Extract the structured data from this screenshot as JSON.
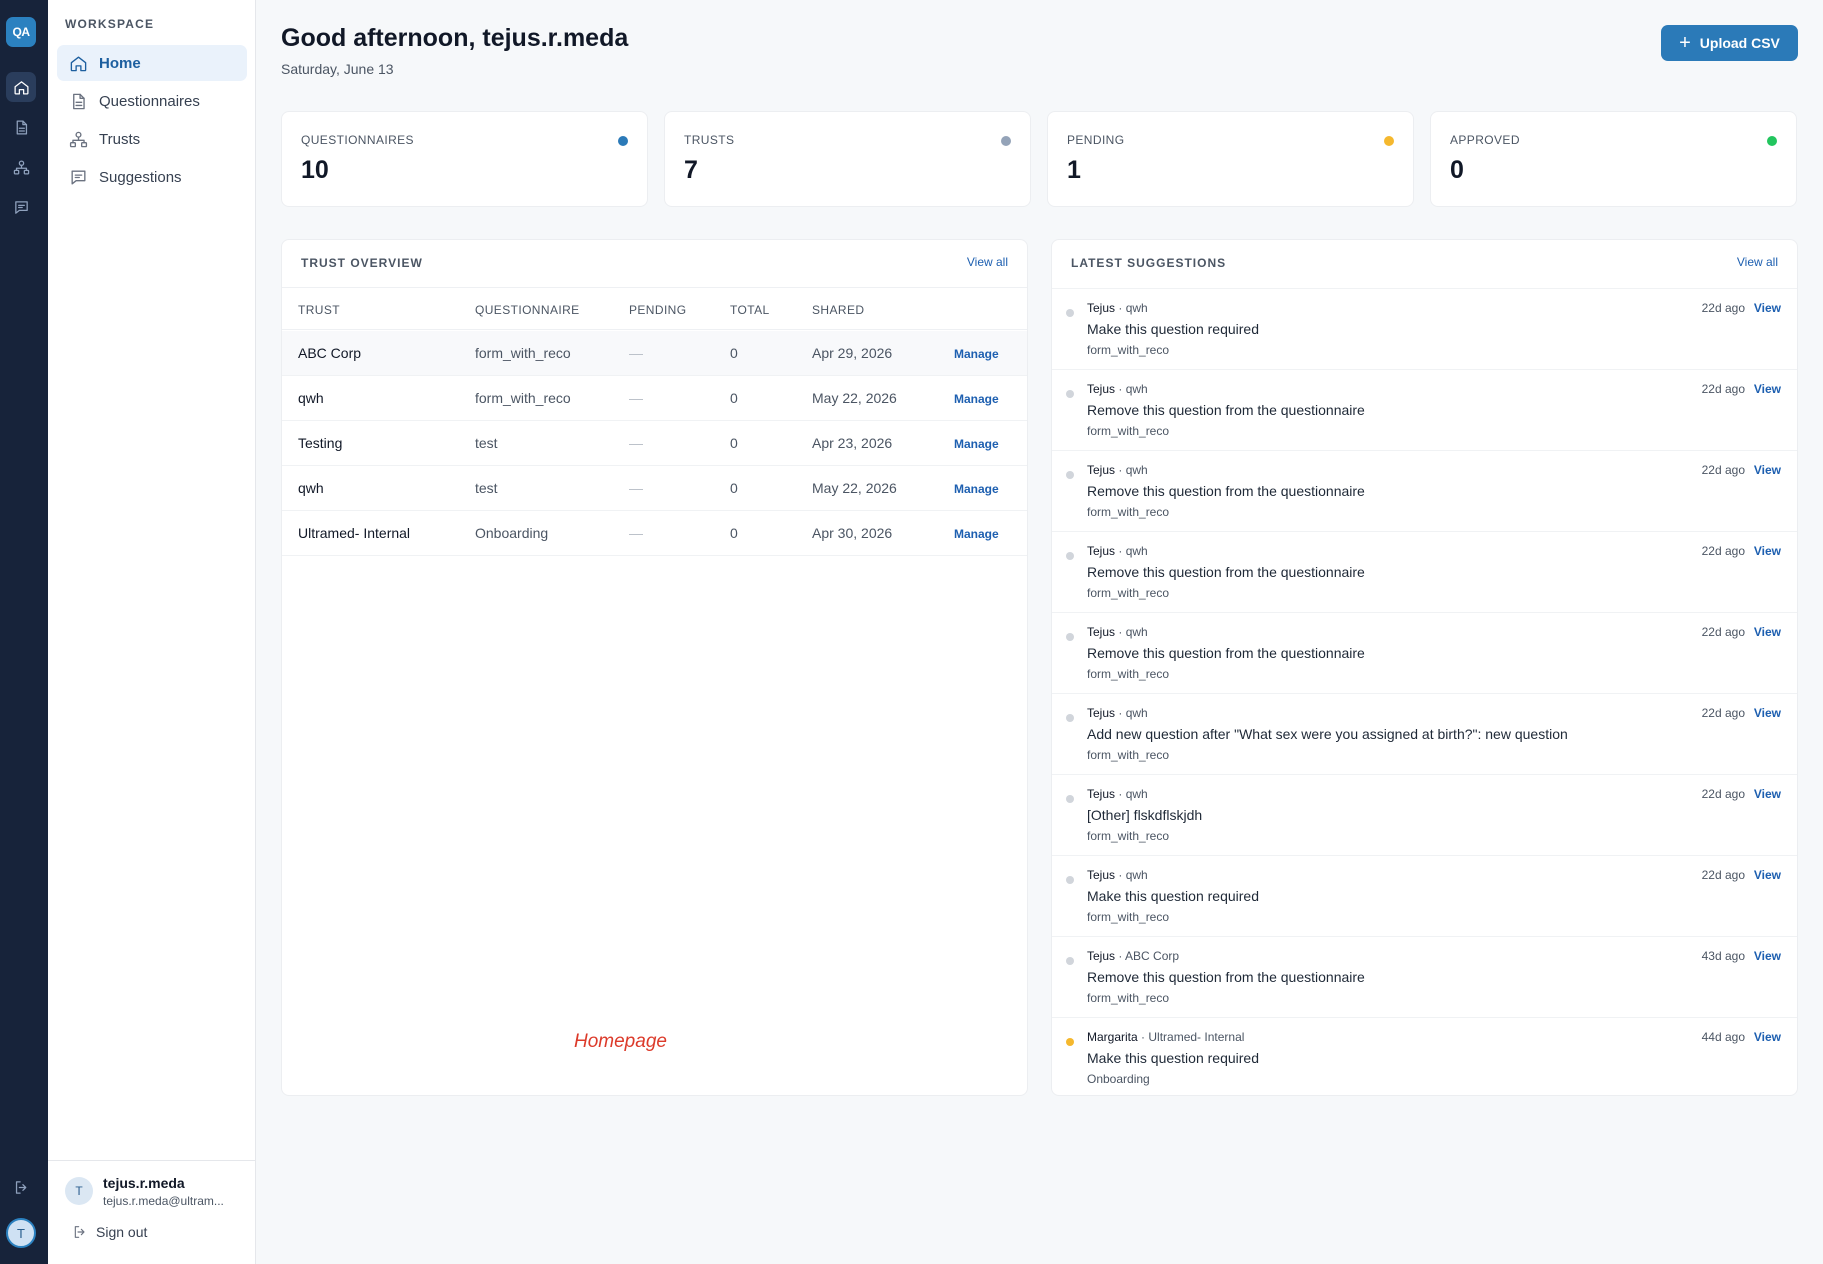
{
  "app": {
    "logo_text": "QA"
  },
  "rail": {
    "icons": [
      "home-icon",
      "document-icon",
      "trusts-icon",
      "chat-icon",
      "logout-icon"
    ],
    "avatar": "T"
  },
  "sidebar": {
    "section_title": "WORKSPACE",
    "items": [
      {
        "label": "Home",
        "icon": "home-icon",
        "active": true
      },
      {
        "label": "Questionnaires",
        "icon": "document-icon",
        "active": false
      },
      {
        "label": "Trusts",
        "icon": "trusts-icon",
        "active": false
      },
      {
        "label": "Suggestions",
        "icon": "chat-icon",
        "active": false
      }
    ],
    "user": {
      "avatar": "T",
      "name": "tejus.r.meda",
      "email": "tejus.r.meda@ultram...",
      "sign_out": "Sign out"
    }
  },
  "header": {
    "greeting": "Good afternoon, tejus.r.meda",
    "date": "Saturday, June 13",
    "upload_button": "Upload CSV"
  },
  "stats": [
    {
      "label": "QUESTIONNAIRES",
      "value": "10",
      "color": "#2b7ab8"
    },
    {
      "label": "TRUSTS",
      "value": "7",
      "color": "#94a3b8"
    },
    {
      "label": "PENDING",
      "value": "1",
      "color": "#f5b82e"
    },
    {
      "label": "APPROVED",
      "value": "0",
      "color": "#22c55e"
    }
  ],
  "trust_overview": {
    "title": "TRUST OVERVIEW",
    "view_all": "View all",
    "columns": [
      "TRUST",
      "QUESTIONNAIRE",
      "PENDING",
      "TOTAL",
      "SHARED"
    ],
    "rows": [
      {
        "trust": "ABC Corp",
        "questionnaire": "form_with_reco",
        "pending": "—",
        "total": "0",
        "shared": "Apr 29, 2026",
        "action": "Manage"
      },
      {
        "trust": "qwh",
        "questionnaire": "form_with_reco",
        "pending": "—",
        "total": "0",
        "shared": "May 22, 2026",
        "action": "Manage"
      },
      {
        "trust": "Testing",
        "questionnaire": "test",
        "pending": "—",
        "total": "0",
        "shared": "Apr 23, 2026",
        "action": "Manage"
      },
      {
        "trust": "qwh",
        "questionnaire": "test",
        "pending": "—",
        "total": "0",
        "shared": "May 22, 2026",
        "action": "Manage"
      },
      {
        "trust": "Ultramed- Internal",
        "questionnaire": "Onboarding",
        "pending": "—",
        "total": "0",
        "shared": "Apr 30, 2026",
        "action": "Manage"
      }
    ],
    "note": "Homepage"
  },
  "latest_suggestions": {
    "title": "LATEST SUGGESTIONS",
    "view_all": "View all",
    "items": [
      {
        "author": "Tejus",
        "sep": "·",
        "trust": "qwh",
        "text": "Make this question required",
        "form": "form_with_reco",
        "ago": "22d ago",
        "action": "View",
        "dot": "#d1d5db"
      },
      {
        "author": "Tejus",
        "sep": "·",
        "trust": "qwh",
        "text": "Remove this question from the questionnaire",
        "form": "form_with_reco",
        "ago": "22d ago",
        "action": "View",
        "dot": "#d1d5db"
      },
      {
        "author": "Tejus",
        "sep": "·",
        "trust": "qwh",
        "text": "Remove this question from the questionnaire",
        "form": "form_with_reco",
        "ago": "22d ago",
        "action": "View",
        "dot": "#d1d5db"
      },
      {
        "author": "Tejus",
        "sep": "·",
        "trust": "qwh",
        "text": "Remove this question from the questionnaire",
        "form": "form_with_reco",
        "ago": "22d ago",
        "action": "View",
        "dot": "#d1d5db"
      },
      {
        "author": "Tejus",
        "sep": "·",
        "trust": "qwh",
        "text": "Remove this question from the questionnaire",
        "form": "form_with_reco",
        "ago": "22d ago",
        "action": "View",
        "dot": "#d1d5db"
      },
      {
        "author": "Tejus",
        "sep": "·",
        "trust": "qwh",
        "text": "Add new question after \"What sex were you assigned at birth?\": new question",
        "form": "form_with_reco",
        "ago": "22d ago",
        "action": "View",
        "dot": "#d1d5db"
      },
      {
        "author": "Tejus",
        "sep": "·",
        "trust": "qwh",
        "text": "[Other] flskdflskjdh",
        "form": "form_with_reco",
        "ago": "22d ago",
        "action": "View",
        "dot": "#d1d5db"
      },
      {
        "author": "Tejus",
        "sep": "·",
        "trust": "qwh",
        "text": "Make this question required",
        "form": "form_with_reco",
        "ago": "22d ago",
        "action": "View",
        "dot": "#d1d5db"
      },
      {
        "author": "Tejus",
        "sep": "·",
        "trust": "ABC Corp",
        "text": "Remove this question from the questionnaire",
        "form": "form_with_reco",
        "ago": "43d ago",
        "action": "View",
        "dot": "#d1d5db"
      },
      {
        "author": "Margarita",
        "sep": "·",
        "trust": "Ultramed- Internal",
        "text": "Make this question required",
        "form": "Onboarding",
        "ago": "44d ago",
        "action": "View",
        "dot": "#f5b82e"
      }
    ]
  }
}
